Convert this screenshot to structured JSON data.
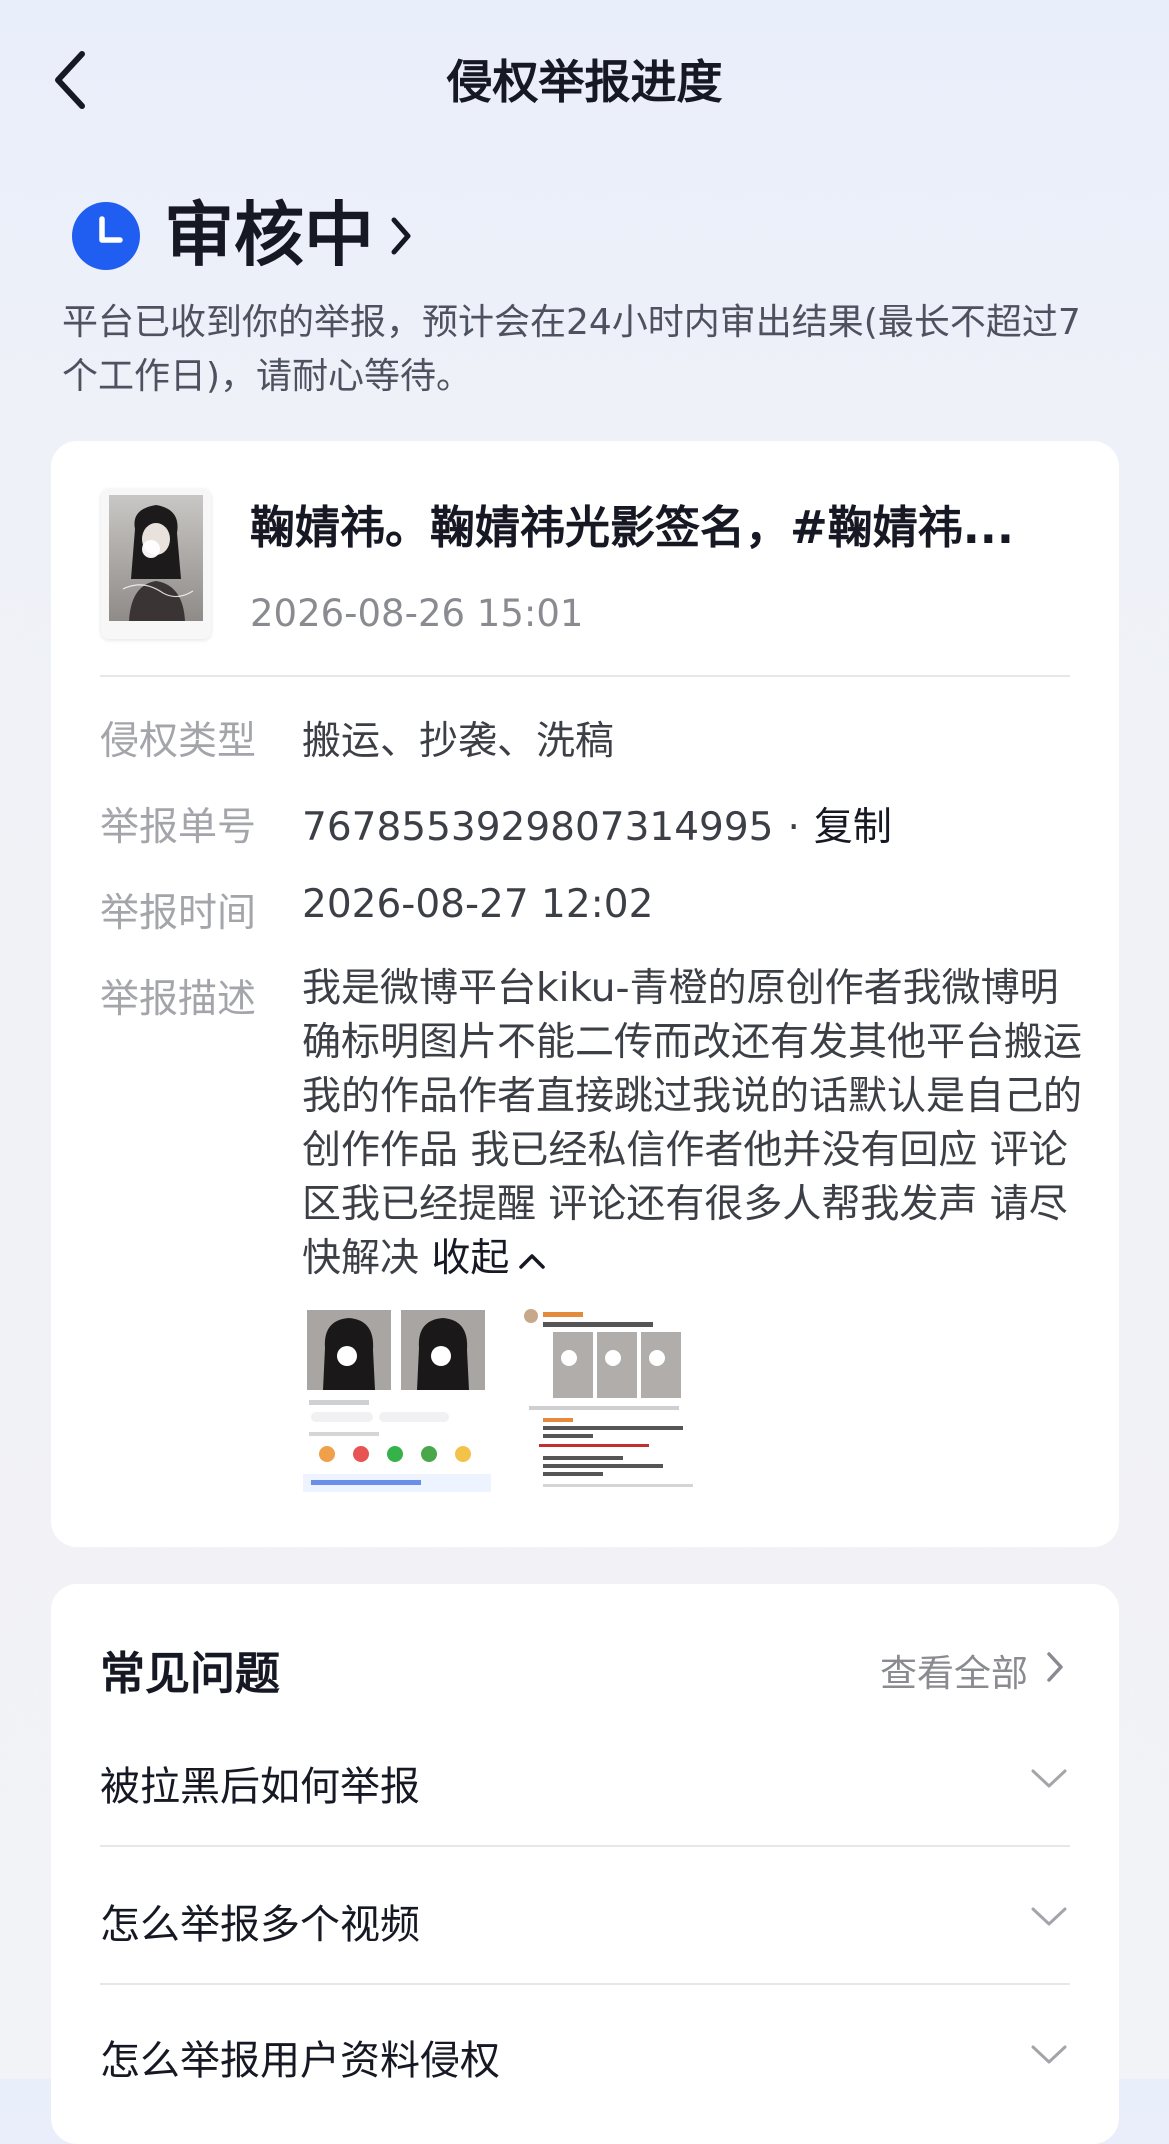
{
  "nav": {
    "title": "侵权举报进度"
  },
  "status": {
    "title": "审核中",
    "description": "平台已收到你的举报，预计会在24小时内审出结果(最长不超过7个工作日)，请耐心等待。"
  },
  "report": {
    "video_title": "鞠婧祎。鞠婧祎光影签名，#鞠婧祎...",
    "video_date": "2026-08-26 15:01",
    "type_label": "侵权类型",
    "type_value": "搬运、抄袭、洗稿",
    "id_label": "举报单号",
    "id_value": "7678553929807314995",
    "copy_label": "复制",
    "time_label": "举报时间",
    "time_value": "2026-08-27 12:02",
    "desc_label": "举报描述",
    "desc_value": "我是微博平台kiku-青橙的原创作者我微博明确标明图片不能二传而改还有发其他平台搬运我的作品作者直接跳过我说的话默认是自己的创作作品 我已经私信作者他并没有回应 评论区我已经提醒 评论还有很多人帮我发声 请尽快解决",
    "collapse_label": "收起"
  },
  "faq": {
    "title": "常见问题",
    "view_all": "查看全部",
    "items": [
      {
        "question": "被拉黑后如何举报"
      },
      {
        "question": "怎么举报多个视频"
      },
      {
        "question": "怎么举报用户资料侵权"
      }
    ]
  },
  "colors": {
    "accent": "#1f5ef0",
    "text": "#161823",
    "muted": "#a4a5aa"
  }
}
